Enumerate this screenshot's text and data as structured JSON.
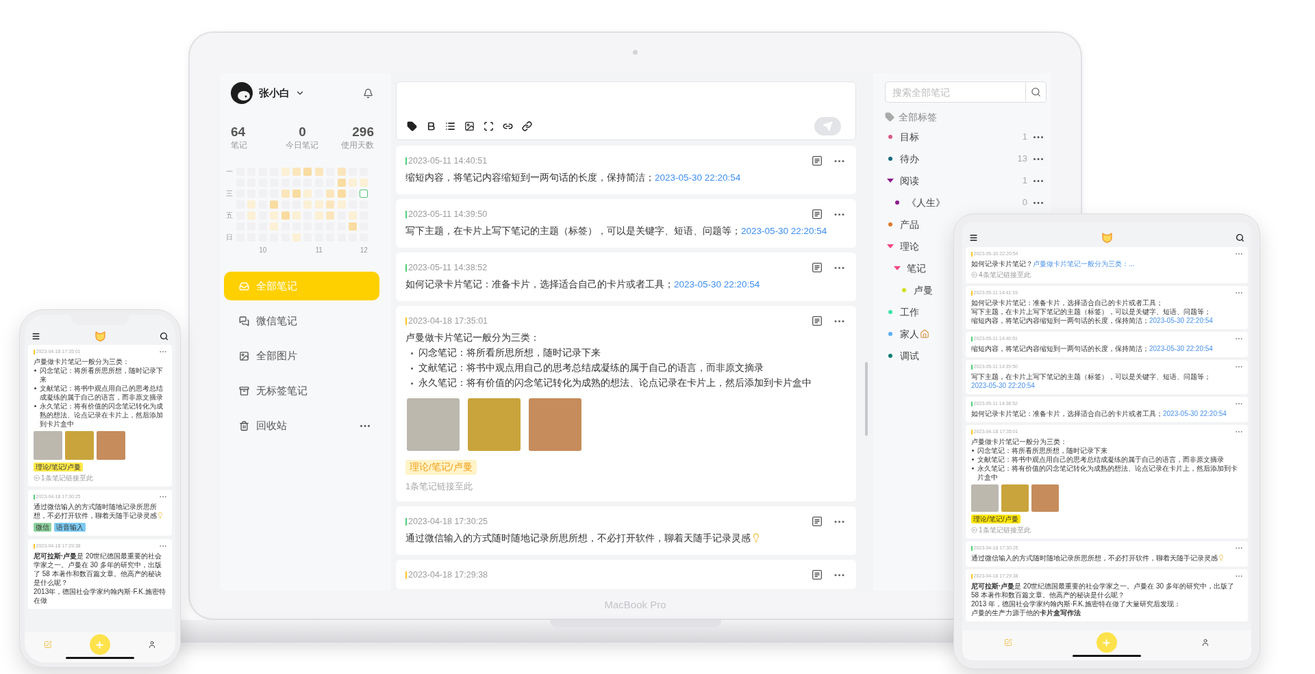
{
  "laptop": {
    "label": "MacBook Pro",
    "sidebar": {
      "user_name": "张小白",
      "stats": [
        {
          "value": "64",
          "label": "笔记"
        },
        {
          "value": "0",
          "label": "今日笔记"
        },
        {
          "value": "296",
          "label": "使用天数"
        }
      ],
      "heatmap": {
        "row_labels": [
          "一",
          "三",
          "五",
          "日"
        ],
        "column_labels": [
          "10",
          "11",
          "12"
        ]
      },
      "nav": [
        {
          "label": "全部笔记",
          "selected": true,
          "more": false
        },
        {
          "label": "微信笔记",
          "selected": false,
          "more": false
        },
        {
          "label": "全部图片",
          "selected": false,
          "more": false
        },
        {
          "label": "无标签笔记",
          "selected": false,
          "more": false
        },
        {
          "label": "回收站",
          "selected": false,
          "more": true
        }
      ]
    },
    "editor": {
      "send_disabled": true
    },
    "notes": [
      {
        "time": "2023-05-11 14:40:51",
        "color": "#4fcf7a",
        "blocks": [
          {
            "kind": "text",
            "text": "缩短内容，将笔记内容缩短到一两句话的长度，保持简洁；",
            "link": "2023-05-30 22:20:54"
          }
        ]
      },
      {
        "time": "2023-05-11 14:39:50",
        "color": "#4fcf7a",
        "blocks": [
          {
            "kind": "text",
            "text": "写下主题，在卡片上写下笔记的主题（标签），可以是关键字、短语、问题等；",
            "link": "2023-05-30 22:20:54"
          }
        ]
      },
      {
        "time": "2023-05-11 14:38:52",
        "color": "#4fcf7a",
        "blocks": [
          {
            "kind": "text",
            "text": "如何记录卡片笔记：准备卡片，选择适合自己的卡片或者工具；",
            "link": "2023-05-30 22:20:54"
          }
        ]
      },
      {
        "time": "2023-04-18 17:35:01",
        "color": "#f9c623",
        "blocks": [
          {
            "kind": "text",
            "text": "卢曼做卡片笔记一般分为三类："
          },
          {
            "kind": "bullet",
            "text": "闪念笔记：将所看所思所想，随时记录下来"
          },
          {
            "kind": "bullet",
            "text": "文献笔记：将书中观点用自己的思考总结成凝练的属于自己的语言，而非原文摘录"
          },
          {
            "kind": "bullet",
            "text": "永久笔记：将有价值的闪念笔记转化为成熟的想法、论点记录在卡片上，然后添加到卡片盒中"
          }
        ],
        "images": [
          {
            "kind": "photo"
          },
          {
            "kind": "photo"
          },
          {
            "kind": "photo"
          }
        ],
        "tags": [
          {
            "label": "理论/笔记/卢曼",
            "color": "#fff3c8"
          }
        ],
        "backlinks": "1条笔记链接至此"
      },
      {
        "time": "2023-04-18 17:30:25",
        "color": "#4fcf7a",
        "blocks": [
          {
            "kind": "text",
            "text": "通过微信输入的方式随时随地记录所思所想，不必打开软件，聊着天随手记录灵感",
            "emoji": true
          }
        ]
      },
      {
        "time": "2023-04-18 17:29:38",
        "color": "#f9c623"
      }
    ],
    "tag_panel": {
      "search_placeholder": "搜索全部笔记",
      "title": "全部标签",
      "tags": [
        {
          "label": "目标",
          "color": "#d85b84",
          "count": "1"
        },
        {
          "label": "待办",
          "color": "#15697e",
          "count": "13"
        },
        {
          "label": "阅读",
          "color": "#8e1b8e",
          "count": "1",
          "expanded": true,
          "children": [
            {
              "label": "《人生》",
              "color": "#8e1b8e",
              "count": "0"
            }
          ]
        },
        {
          "label": "产品",
          "color": "#dc7a2a"
        },
        {
          "label": "理论",
          "color": "#f2467e",
          "expanded": true,
          "children": [
            {
              "label": "笔记",
              "color": "#f2467e",
              "expanded": true,
              "children": [
                {
                  "label": "卢曼",
                  "color": "#cde21c"
                }
              ]
            }
          ]
        },
        {
          "label": "工作",
          "color": "#3fe3a4"
        },
        {
          "label": "家人",
          "color": "#5eaef2",
          "emoji": true
        },
        {
          "label": "调试",
          "color": "#0f7f72"
        }
      ]
    }
  },
  "phone": {
    "notes": [
      {
        "time": "2023-04-18 17:35:01",
        "color": "#f9c623",
        "blocks": [
          {
            "kind": "text",
            "text": "卢曼做卡片笔记一般分为三类："
          },
          {
            "kind": "bullet",
            "text": "闪念笔记：将所看所思所想，随时记录下来"
          },
          {
            "kind": "bullet",
            "text": "文献笔记：将书中观点用自己的思考总结成凝练的属于自己的语言，而非原文摘录"
          },
          {
            "kind": "bullet",
            "text": "永久笔记：将有价值的闪念笔记转化为成熟的想法、论点记录在卡片上，然后添加到卡片盒中"
          }
        ],
        "images": [
          {
            "kind": "photo"
          },
          {
            "kind": "photo"
          },
          {
            "kind": "photo"
          }
        ],
        "tags": [
          {
            "label": "理论/笔记/卢曼",
            "color": "#ffe94a"
          }
        ],
        "backlinks": "1条笔记链接至此"
      },
      {
        "time": "2023-04-18 17:30:25",
        "color": "#4fcf7a",
        "blocks": [
          {
            "kind": "text",
            "text": "通过微信输入的方式随时随地记录所思所想，不必打开软件，聊着天随手记录灵感",
            "emoji": true
          }
        ],
        "tags": [
          {
            "label": "微信",
            "color": "#8fd3a0"
          },
          {
            "label": "语音输入",
            "color": "#7ccaf2"
          }
        ]
      },
      {
        "time": "2023-04-18 17:29:38",
        "color": "#f9c623",
        "blocks": [
          {
            "kind": "text",
            "text": "**尼可拉斯·卢曼**是 20世纪德国最重要的社会学家之一。卢曼在 30 多年的研究中，出版了 58 本著作和数百篇文章。他高产的秘诀是什么呢？"
          },
          {
            "kind": "text",
            "text": "2013年，德国社会学家约翰内斯·F.K.施密特在做"
          }
        ]
      }
    ]
  },
  "tablet": {
    "notes": [
      {
        "time": "2023-05-30 22:20:54",
        "color": "#f9c623",
        "blocks": [
          {
            "kind": "text",
            "text": "如何记录卡片笔记？",
            "link": "卢曼做卡片笔记一般分为三类：..."
          }
        ],
        "backlinks": "4条笔记链接至此"
      },
      {
        "time": "2023-05-11 14:41:19",
        "color": "#f9c623",
        "blocks": [
          {
            "kind": "text",
            "text": "如何记录卡片笔记：准备卡片，选择适合自己的卡片或者工具；"
          },
          {
            "kind": "text",
            "text": "写下主题，在卡片上写下笔记的主题（标签），可以是关键字、短语、问题等；"
          },
          {
            "kind": "text",
            "text": "缩短内容，将笔记内容缩短到一两句话的长度，保持简洁；",
            "link": "2023-05-30 22:20:54"
          }
        ]
      },
      {
        "time": "2023-05-11 14:40:51",
        "color": "#4fcf7a",
        "blocks": [
          {
            "kind": "text",
            "text": "缩短内容，将笔记内容缩短到一两句话的长度，保持简洁；",
            "link": "2023-05-30 22:20:54"
          }
        ]
      },
      {
        "time": "2023-05-11 14:39:50",
        "color": "#4fcf7a",
        "blocks": [
          {
            "kind": "text",
            "text": "写下主题，在卡片上写下笔记的主题（标签），可以是关键字、短语、问题等；",
            "link": "2023-05-30 22:20:54"
          }
        ]
      },
      {
        "time": "2023-05-11 14:38:52",
        "color": "#4fcf7a",
        "blocks": [
          {
            "kind": "text",
            "text": "如何记录卡片笔记：准备卡片，选择适合自己的卡片或者工具；",
            "link": "2023-05-30 22:20:54"
          }
        ]
      },
      {
        "time": "2023-04-18 17:35:01",
        "color": "#f9c623",
        "blocks": [
          {
            "kind": "text",
            "text": "卢曼做卡片笔记一般分为三类："
          },
          {
            "kind": "bullet",
            "text": "闪念笔记：将所看所思所想，随时记录下来"
          },
          {
            "kind": "bullet",
            "text": "文献笔记：将书中观点用自己的思考总结成凝练的属于自己的语言，而非原文摘录"
          },
          {
            "kind": "bullet",
            "text": "永久笔记：将有价值的闪念笔记转化为成熟的想法、论点记录在卡片上，然后添加到卡片盒中"
          }
        ],
        "images": [
          {
            "kind": "photo"
          },
          {
            "kind": "photo"
          },
          {
            "kind": "photo"
          }
        ],
        "tags": [
          {
            "label": "理论/笔记/卢曼",
            "color": "#ffe600"
          }
        ],
        "backlinks": "1条笔记链接至此"
      },
      {
        "time": "2023-04-18 17:30:25",
        "color": "#4fcf7a",
        "blocks": [
          {
            "kind": "text",
            "text": "通过微信输入的方式随时随地记录所思所想，不必打开软件，聊着天随手记录灵感",
            "emoji": true
          }
        ]
      },
      {
        "time": "2023-04-18 17:29:38",
        "color": "#f9c623",
        "blocks": [
          {
            "kind": "text",
            "text": "**尼可拉斯·卢曼**是 20世纪德国最重要的社会学家之一。卢曼在 30 多年的研究中，出版了 58 本著作和数百篇文章。他高产的秘诀是什么呢？"
          },
          {
            "kind": "text",
            "text": "2013 年，德国社会学家约翰内斯·F.K.施密特在做了大量研究后发现："
          },
          {
            "kind": "text",
            "text": "卢曼的生产力源于他的**卡片盒写作法**"
          }
        ]
      }
    ]
  }
}
